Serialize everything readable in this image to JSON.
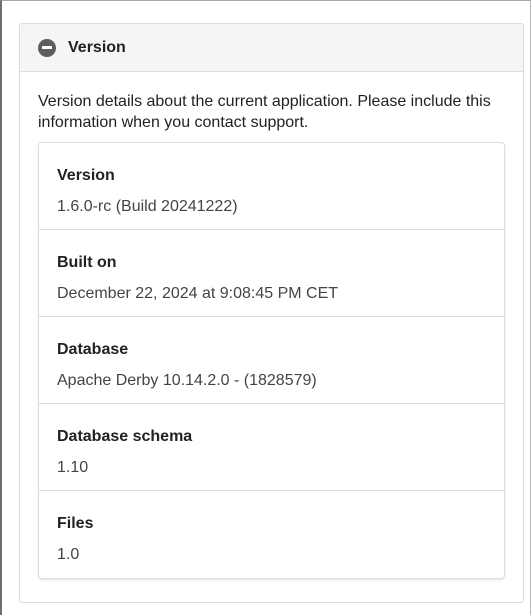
{
  "panel": {
    "title": "Version",
    "icon": "collapse-icon",
    "description": "Version details about the current application. Please include this information when you contact support."
  },
  "details": [
    {
      "label": "Version",
      "value": "1.6.0-rc (Build 20241222)"
    },
    {
      "label": "Built on",
      "value": "December 22, 2024 at 9:08:45 PM CET"
    },
    {
      "label": "Database",
      "value": "Apache Derby 10.14.2.0 - (1828579)"
    },
    {
      "label": "Database schema",
      "value": "1.10"
    },
    {
      "label": "Files",
      "value": "1.0"
    }
  ]
}
